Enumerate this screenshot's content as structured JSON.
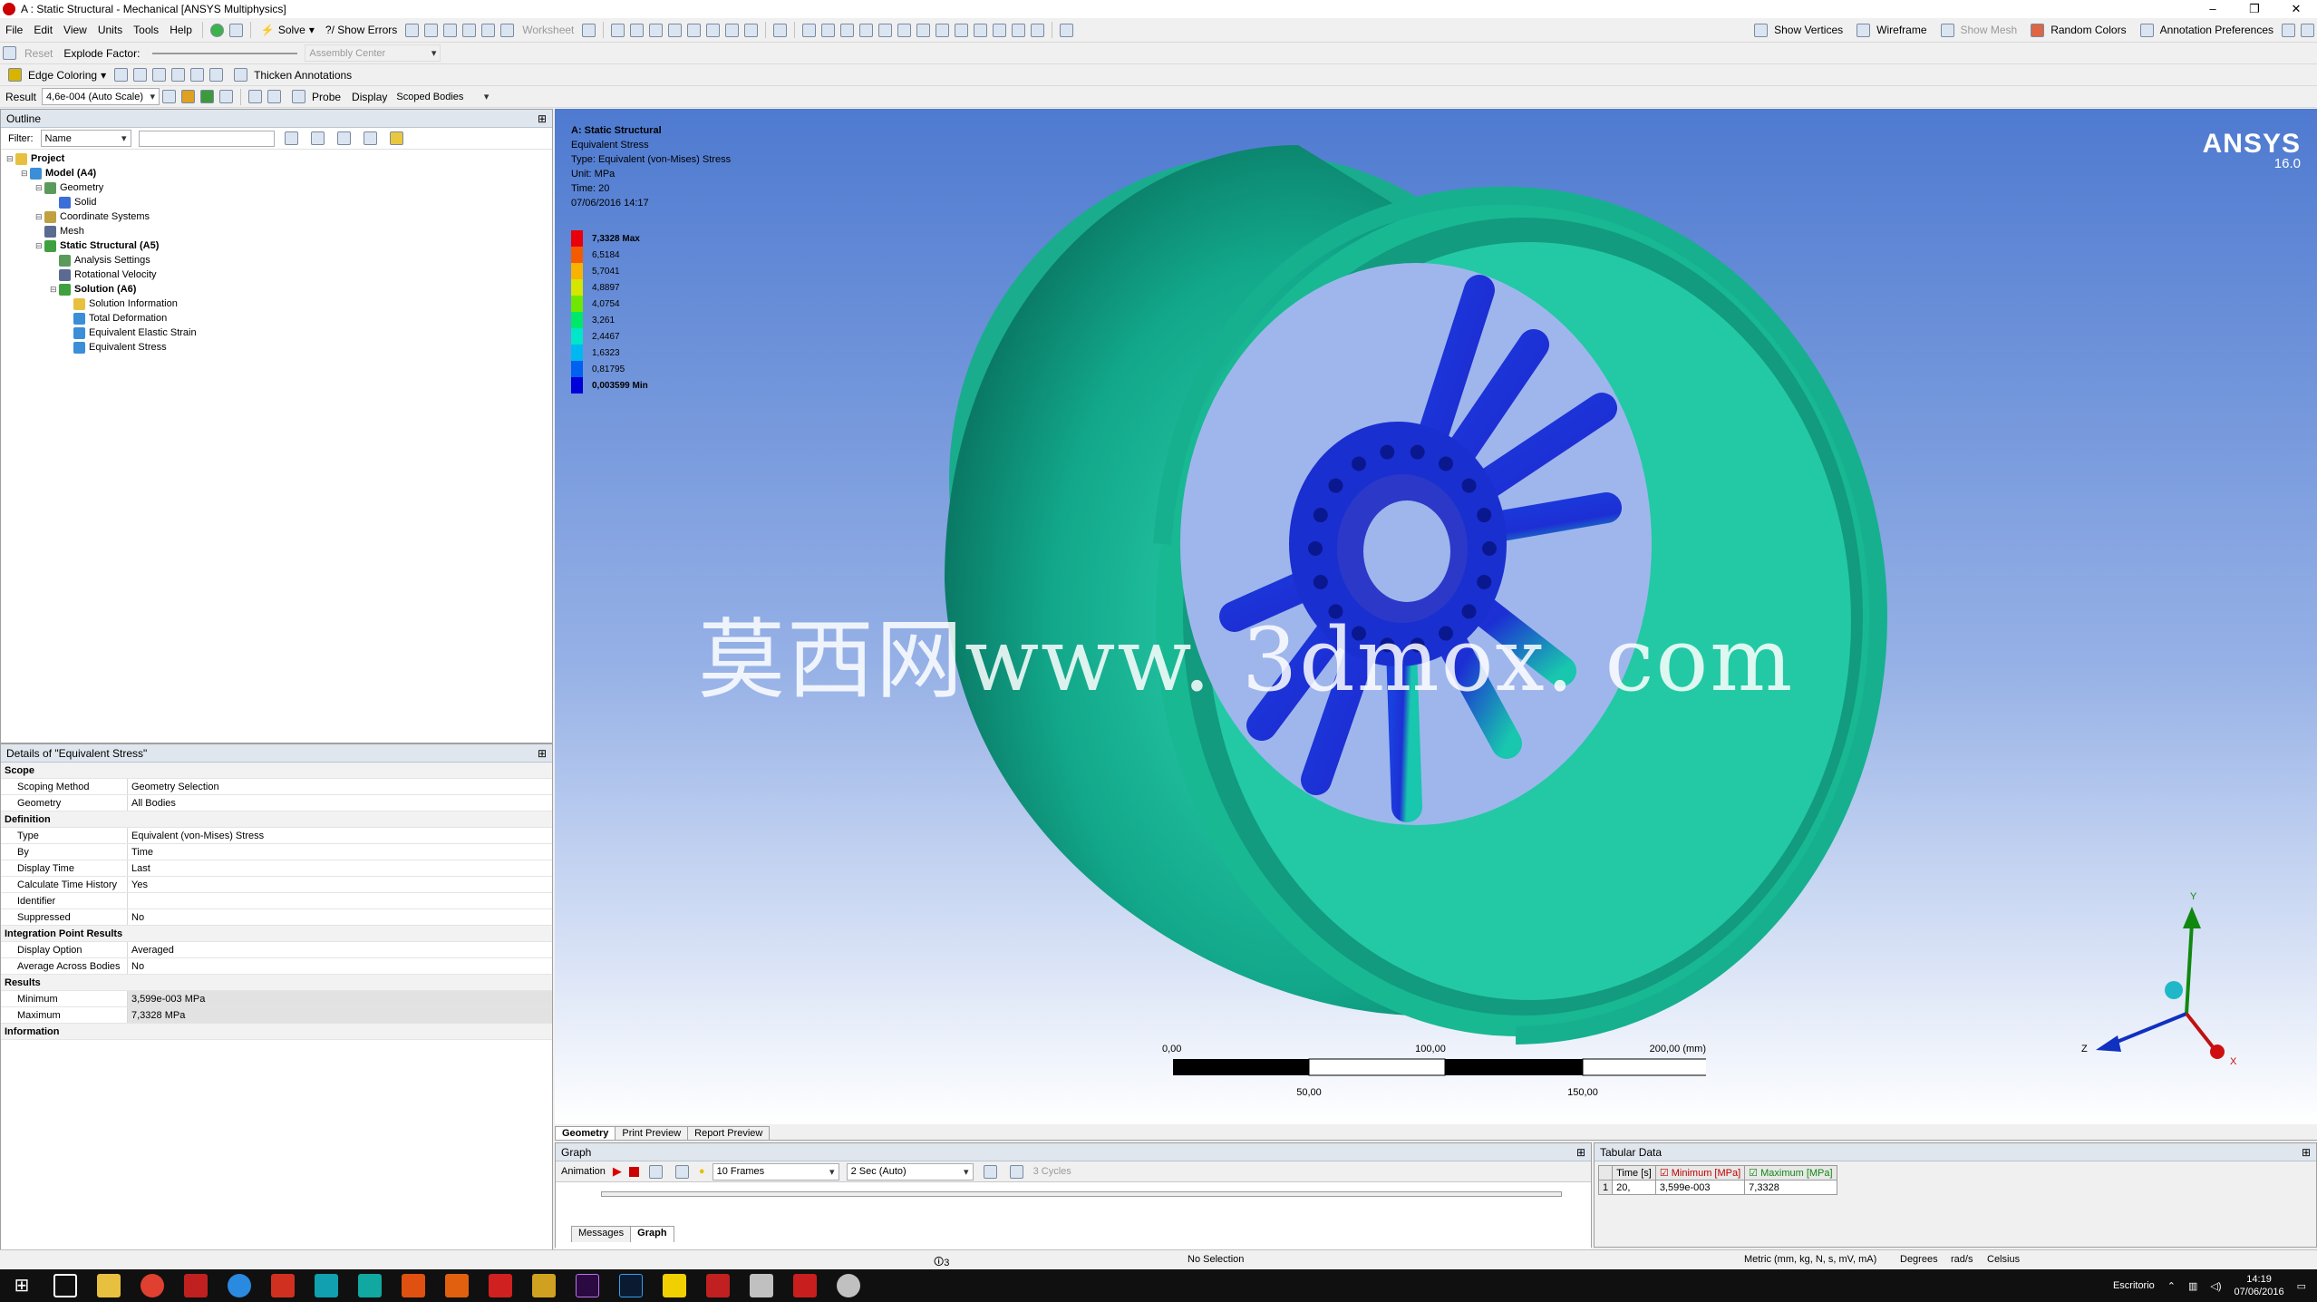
{
  "window": {
    "title": "A : Static Structural - Mechanical [ANSYS Multiphysics]",
    "controls": [
      "–",
      "❐",
      "✕"
    ]
  },
  "menu": {
    "items": [
      "File",
      "Edit",
      "View",
      "Units",
      "Tools",
      "Help"
    ]
  },
  "toolbar1": {
    "solve_label": "Solve",
    "show_errors_label": "?/ Show Errors",
    "worksheet_label": "Worksheet",
    "show_vertices_label": "Show Vertices",
    "wireframe_label": "Wireframe",
    "show_mesh_label": "Show Mesh",
    "random_colors_label": "Random Colors",
    "annotation_prefs_label": "Annotation Preferences"
  },
  "toolbar2": {
    "reset_label": "Reset",
    "explode_factor_label": "Explode Factor:",
    "assembly_center_label": "Assembly Center"
  },
  "toolbar3": {
    "edge_coloring_label": "Edge Coloring",
    "thicken_annotations_label": "Thicken Annotations"
  },
  "toolbar4": {
    "result_label": "Result",
    "result_scale_value": "4,6e-004 (Auto Scale)",
    "probe_label": "Probe",
    "display_label": "Display",
    "display_value": "Scoped Bodies"
  },
  "outline": {
    "title": "Outline",
    "filter_label": "Filter:",
    "filter_value": "Name",
    "tree": [
      {
        "label": "Project",
        "depth": 0,
        "bold": true
      },
      {
        "label": "Model (A4)",
        "depth": 1,
        "bold": true
      },
      {
        "label": "Geometry",
        "depth": 2,
        "bold": false
      },
      {
        "label": "Solid",
        "depth": 3,
        "bold": false
      },
      {
        "label": "Coordinate Systems",
        "depth": 2,
        "bold": false
      },
      {
        "label": "Mesh",
        "depth": 2,
        "bold": false
      },
      {
        "label": "Static Structural (A5)",
        "depth": 2,
        "bold": true
      },
      {
        "label": "Analysis Settings",
        "depth": 3,
        "bold": false
      },
      {
        "label": "Rotational Velocity",
        "depth": 3,
        "bold": false
      },
      {
        "label": "Solution (A6)",
        "depth": 3,
        "bold": true
      },
      {
        "label": "Solution Information",
        "depth": 4,
        "bold": false
      },
      {
        "label": "Total Deformation",
        "depth": 4,
        "bold": false
      },
      {
        "label": "Equivalent Elastic Strain",
        "depth": 4,
        "bold": false
      },
      {
        "label": "Equivalent Stress",
        "depth": 4,
        "bold": false
      }
    ]
  },
  "details": {
    "title": "Details of \"Equivalent Stress\"",
    "rows": [
      {
        "type": "cat",
        "k": "Scope"
      },
      {
        "type": "row",
        "k": "Scoping Method",
        "v": "Geometry Selection"
      },
      {
        "type": "row",
        "k": "Geometry",
        "v": "All Bodies"
      },
      {
        "type": "cat",
        "k": "Definition"
      },
      {
        "type": "row",
        "k": "Type",
        "v": "Equivalent (von-Mises) Stress"
      },
      {
        "type": "row",
        "k": "By",
        "v": "Time"
      },
      {
        "type": "row",
        "k": "Display Time",
        "v": "Last"
      },
      {
        "type": "row",
        "k": "Calculate Time History",
        "v": "Yes"
      },
      {
        "type": "row",
        "k": "Identifier",
        "v": ""
      },
      {
        "type": "row",
        "k": "Suppressed",
        "v": "No"
      },
      {
        "type": "cat",
        "k": "Integration Point Results"
      },
      {
        "type": "row",
        "k": "Display Option",
        "v": "Averaged"
      },
      {
        "type": "row",
        "k": "Average Across Bodies",
        "v": "No"
      },
      {
        "type": "cat",
        "k": "Results"
      },
      {
        "type": "grey",
        "k": "Minimum",
        "v": "3,599e-003 MPa"
      },
      {
        "type": "grey",
        "k": "Maximum",
        "v": "7,3328 MPa"
      },
      {
        "type": "cat",
        "k": "Information"
      }
    ]
  },
  "viewport": {
    "info": {
      "title": "A: Static Structural",
      "result": "Equivalent Stress",
      "type": "Type: Equivalent (von-Mises) Stress",
      "unit": "Unit: MPa",
      "time": "Time: 20",
      "date": "07/06/2016 14:17"
    },
    "legend": [
      {
        "label": "7,3328 Max",
        "color": "#e8000b"
      },
      {
        "label": "6,5184",
        "color": "#f45a00"
      },
      {
        "label": "5,7041",
        "color": "#f7b300"
      },
      {
        "label": "4,8897",
        "color": "#d5e600"
      },
      {
        "label": "4,0754",
        "color": "#6fe800"
      },
      {
        "label": "3,261",
        "color": "#00e86a"
      },
      {
        "label": "2,4467",
        "color": "#00e6c8"
      },
      {
        "label": "1,6323",
        "color": "#00b8f0"
      },
      {
        "label": "0,81795",
        "color": "#0060f0"
      },
      {
        "label": "0,003599 Min",
        "color": "#0000d8"
      }
    ],
    "logo": {
      "name": "ANSYS",
      "version": "16.0"
    },
    "watermark": "莫西网www. 3dmox. com",
    "scale": {
      "top_labels": [
        "0,00",
        "100,00",
        "200,00 (mm)"
      ],
      "bottom_labels": [
        "50,00",
        "150,00"
      ]
    },
    "axes": {
      "x": "X",
      "y": "Y",
      "z": "Z"
    }
  },
  "viewport_tabs": [
    "Geometry",
    "Print Preview",
    "Report Preview"
  ],
  "graph": {
    "title": "Graph",
    "animation_label": "Animation",
    "frames_value": "10 Frames",
    "duration_value": "2 Sec (Auto)",
    "cycles_label": "3 Cycles",
    "tabs": [
      "Messages",
      "Graph"
    ]
  },
  "tabular": {
    "title": "Tabular Data",
    "headers": [
      "Time [s]",
      "Minimum [MPa]",
      "Maximum [MPa]"
    ],
    "row": [
      "1",
      "20,",
      "3,599e-003",
      "7,3328"
    ]
  },
  "status": {
    "messages": "3 Messages",
    "selection": "No Selection",
    "units": "Metric (mm, kg, N, s, mV, mA)",
    "degrees": "Degrees",
    "rads": "rad/s",
    "temp": "Celsius"
  },
  "taskbar": {
    "location": "Escritorio",
    "time": "14:19",
    "date": "07/06/2016"
  },
  "colors": {
    "wheel_teal": "#1ab28f",
    "hub_blue": "#1a2fd0",
    "title_red": "#c00000"
  }
}
